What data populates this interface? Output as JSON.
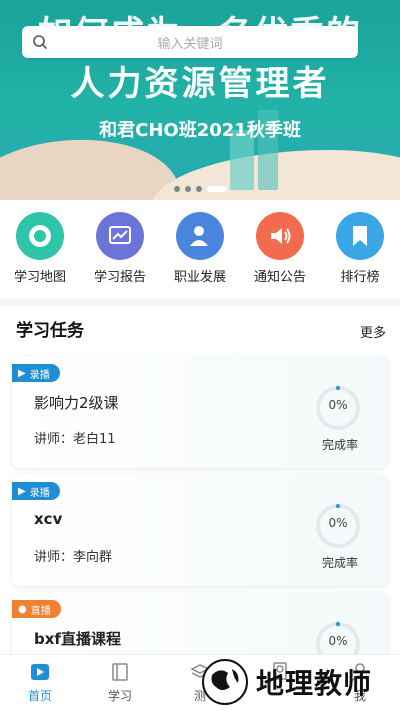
{
  "search": {
    "placeholder": "输入关键词"
  },
  "banner": {
    "top_text": "如何成为一名优秀的",
    "title": "人力资源管理者",
    "subtitle": "和君CHO班2021秋季班",
    "slide_count": 4,
    "active_slide": 4
  },
  "quick_nav": [
    {
      "label": "学习地图",
      "icon": "map-target-icon",
      "color": "#2fc5a8"
    },
    {
      "label": "学习报告",
      "icon": "chart-report-icon",
      "color": "#6b74d8"
    },
    {
      "label": "职业发展",
      "icon": "person-career-icon",
      "color": "#4a86de"
    },
    {
      "label": "通知公告",
      "icon": "speaker-icon",
      "color": "#f26b4e"
    },
    {
      "label": "排行榜",
      "icon": "bookmark-icon",
      "color": "#3aa6e6"
    }
  ],
  "section": {
    "title": "学习任务",
    "more": "更多"
  },
  "tasks": [
    {
      "tag": "录播",
      "title": "影响力2级课",
      "teacher": "讲师：老白11",
      "progress": "0%",
      "status": "完成率"
    },
    {
      "tag": "录播",
      "title": "xcv",
      "teacher": "讲师：李向群",
      "progress": "0%",
      "status": "完成率"
    },
    {
      "tag": "直播",
      "title": "bxf直播课程",
      "teacher": "",
      "progress": "0%",
      "status": ""
    }
  ],
  "tabbar": [
    {
      "label": "首页",
      "icon": "home-icon",
      "active": true
    },
    {
      "label": "学习",
      "icon": "book-icon",
      "active": false
    },
    {
      "label": "测",
      "icon": "exam-icon",
      "active": false
    },
    {
      "label": "",
      "icon": "certificate-icon",
      "active": false
    },
    {
      "label": "我",
      "icon": "user-icon",
      "active": false
    }
  ],
  "watermark": {
    "text": "地理教师"
  },
  "colors": {
    "accent": "#1e8fd6",
    "banner": "#22b3a8",
    "live": "#f08032",
    "ring": "#2a9fd8"
  }
}
